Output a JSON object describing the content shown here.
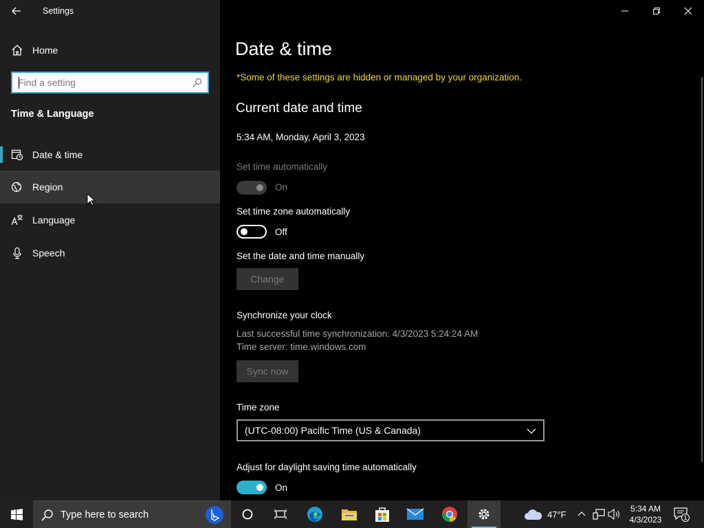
{
  "app": {
    "title": "Settings"
  },
  "sidebar": {
    "home_label": "Home",
    "search_placeholder": "Find a setting",
    "section_title": "Time & Language",
    "items": [
      {
        "label": "Date & time",
        "icon": "clock-calendar-icon",
        "selected": true
      },
      {
        "label": "Region",
        "icon": "globe-icon",
        "hover": true
      },
      {
        "label": "Language",
        "icon": "language-icon"
      },
      {
        "label": "Speech",
        "icon": "microphone-icon"
      }
    ]
  },
  "main": {
    "page_title": "Date & time",
    "org_notice": "*Some of these settings are hidden or managed by your organization.",
    "current_header": "Current date and time",
    "current_datetime": "5:34 AM, Monday, April 3, 2023",
    "set_time_auto": {
      "label": "Set time automatically",
      "state": "On",
      "enabled": false
    },
    "set_tz_auto": {
      "label": "Set time zone automatically",
      "state": "Off",
      "enabled": true
    },
    "manual": {
      "label": "Set the date and time manually",
      "button": "Change"
    },
    "sync": {
      "title": "Synchronize your clock",
      "last_sync": "Last successful time synchronization: 4/3/2023 5:24:24 AM",
      "server": "Time server: time.windows.com",
      "button": "Sync now"
    },
    "timezone": {
      "label": "Time zone",
      "value": "(UTC-08:00) Pacific Time (US & Canada)"
    },
    "dst": {
      "label": "Adjust for daylight saving time automatically",
      "state": "On"
    }
  },
  "taskbar": {
    "search_placeholder": "Type here to search",
    "weather": "47°F",
    "time": "5:34 AM",
    "date": "4/3/2023",
    "notification_count": "1"
  },
  "colors": {
    "accent": "#3aa7c4",
    "notice": "#f0d53c",
    "toggle_on": "#2bb0cc"
  }
}
